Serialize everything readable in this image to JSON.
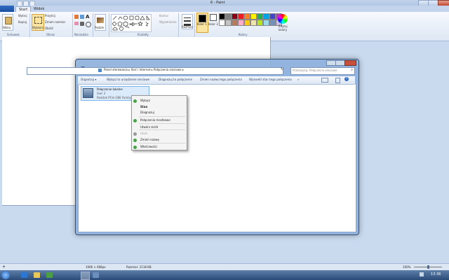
{
  "paint": {
    "title": "6 - Paint",
    "tabs": [
      "Start",
      "Widok"
    ],
    "groups": {
      "clipboard": {
        "label": "Schowek",
        "paste": "Wklej",
        "cut": "Wytnij",
        "copy": "Kopiuj"
      },
      "image": {
        "label": "Obraz",
        "select": "Wybierz",
        "crop": "Przytnij",
        "resize": "Zmień rozmiar",
        "rotate": "Obróć"
      },
      "tools": {
        "label": "Narzędzia"
      },
      "brushes": {
        "label": "Pędzle"
      },
      "shapes": {
        "label": "Kształty",
        "outline": "Kontur",
        "fill": "Wypełnienie"
      },
      "size": {
        "label": "Rozmiar"
      },
      "colors": {
        "label": "Kolory",
        "color1": "Kolor 1",
        "color2": "Kolor 2",
        "edit": "Edytuj kolory"
      }
    },
    "palette": [
      "#000000",
      "#7f7f7f",
      "#880015",
      "#ed1c24",
      "#ff7f27",
      "#fff200",
      "#22b14c",
      "#00a2e8",
      "#3f48cc",
      "#a349a4",
      "#ffffff",
      "#c3c3c3",
      "#b97a57",
      "#ffaec9",
      "#ffc90e",
      "#efe4b0",
      "#b5e61d",
      "#99d9ea",
      "#7092be",
      "#c8bfe7"
    ],
    "status": {
      "dimensions": "1066 × 608px",
      "size": "Rozmiar: 2118 KB",
      "zoom": "100%"
    }
  },
  "explorer": {
    "breadcrumb": [
      "Panel sterowania",
      "Sieć i Internet",
      "Połączenia sieciowe"
    ],
    "search_placeholder": "Przeszukaj: Połączenia sieciowe",
    "commands": [
      "Organizuj ▾",
      "Wyłącz to urządzenie sieciowe",
      "Diagnozuj to połączenie",
      "Zmień nazwę tego połączenia",
      "Wyświetl stan tego połączenia",
      "»"
    ],
    "connection": {
      "name": "Połączenie lokalne",
      "status": "Sieć 3",
      "adapter": "Realtek PCIe GBE Family..."
    }
  },
  "context_menu": {
    "items": [
      {
        "label": "Wyłącz",
        "bold": false,
        "disabled": false,
        "icon": true
      },
      {
        "label": "Stan",
        "bold": true,
        "disabled": false,
        "icon": false
      },
      {
        "label": "Diagnozuj",
        "bold": false,
        "disabled": false,
        "icon": false
      },
      {
        "label": "Połączenia mostkowe",
        "bold": false,
        "disabled": false,
        "icon": true
      },
      {
        "label": "Utwórz skrót",
        "bold": false,
        "disabled": false,
        "icon": false
      },
      {
        "label": "Usuń",
        "bold": false,
        "disabled": true,
        "icon": true
      },
      {
        "label": "Zmień nazwę",
        "bold": false,
        "disabled": false,
        "icon": true
      },
      {
        "label": "Właściwości",
        "bold": false,
        "disabled": false,
        "icon": true
      }
    ]
  },
  "taskbar": {
    "clock": "13:36"
  }
}
